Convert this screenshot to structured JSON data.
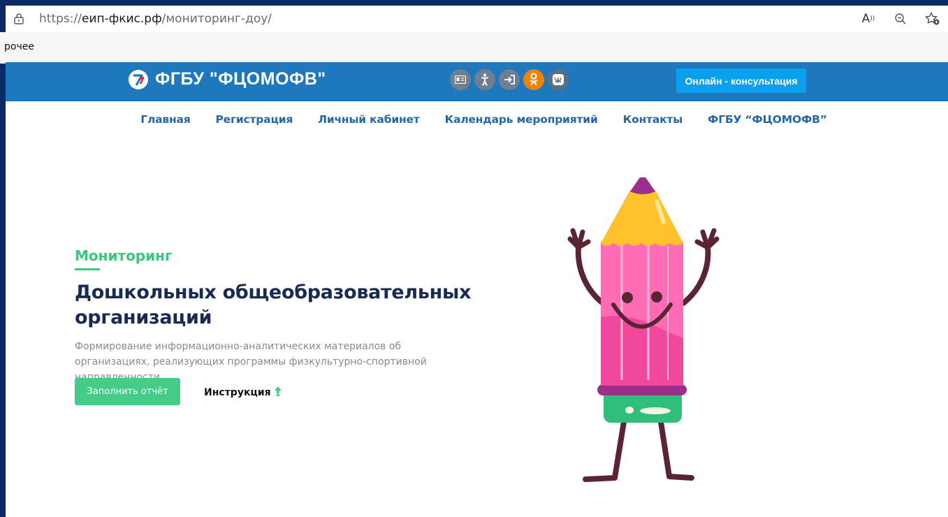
{
  "browser": {
    "url_prefix": "https://",
    "url_host": "еип-фкис.рф",
    "url_path": "/мониторинг-доу/",
    "bookmark": "рочее",
    "read_aloud_icon": "read-aloud-icon",
    "zoom_icon": "zoom-out-icon",
    "favorite_icon": "add-favorite-icon"
  },
  "header": {
    "logo_text": "ФГБУ \"ФЦОМОФВ\"",
    "consult_label": "Онлайн - консультация",
    "icons": [
      "id-card-icon",
      "accessibility-icon",
      "login-icon",
      "odnoklassniki-icon",
      "vk-icon"
    ],
    "vk_label": "vk"
  },
  "nav": {
    "items": [
      "Главная",
      "Регистрация",
      "Личный кабинет",
      "Календарь мероприятий",
      "Контакты",
      "ФГБУ “ФЦОМОФВ”"
    ]
  },
  "hero": {
    "kicker": "Мониторинг",
    "title": "Дошкольных общеобразовательных организаций",
    "description": "Формирование информационно-аналитических материалов об организациях, реализующих программы физкультурно-спортивной направленности",
    "fill_button": "Заполнить отчёт",
    "instruction_link": "Инструкция",
    "accent_color": "#44cc88",
    "brand_color": "#1e78bd"
  }
}
